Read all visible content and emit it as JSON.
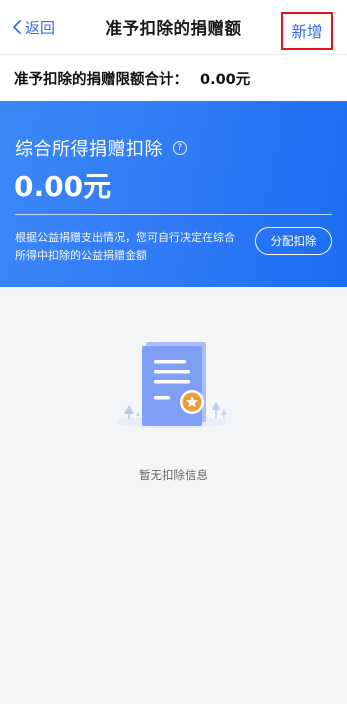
{
  "nav": {
    "back_label": "返回",
    "title": "准予扣除的捐赠额",
    "add_label": "新增"
  },
  "limit": {
    "label": "准予扣除的捐赠限额合计：",
    "value": "0.00元"
  },
  "card": {
    "title": "综合所得捐赠扣除",
    "amount": "0.00元",
    "description": "根据公益捐赠支出情况，您可自行决定在综合所得中扣除的公益捐赠金额",
    "button_label": "分配扣除"
  },
  "empty_state": {
    "message": "暂无扣除信息",
    "icon": "document-empty-icon"
  },
  "colors": {
    "accent": "#2f6df2",
    "card_bg": "#2f79f5",
    "highlight_border": "#e8141b",
    "badge": "#f29a38"
  }
}
